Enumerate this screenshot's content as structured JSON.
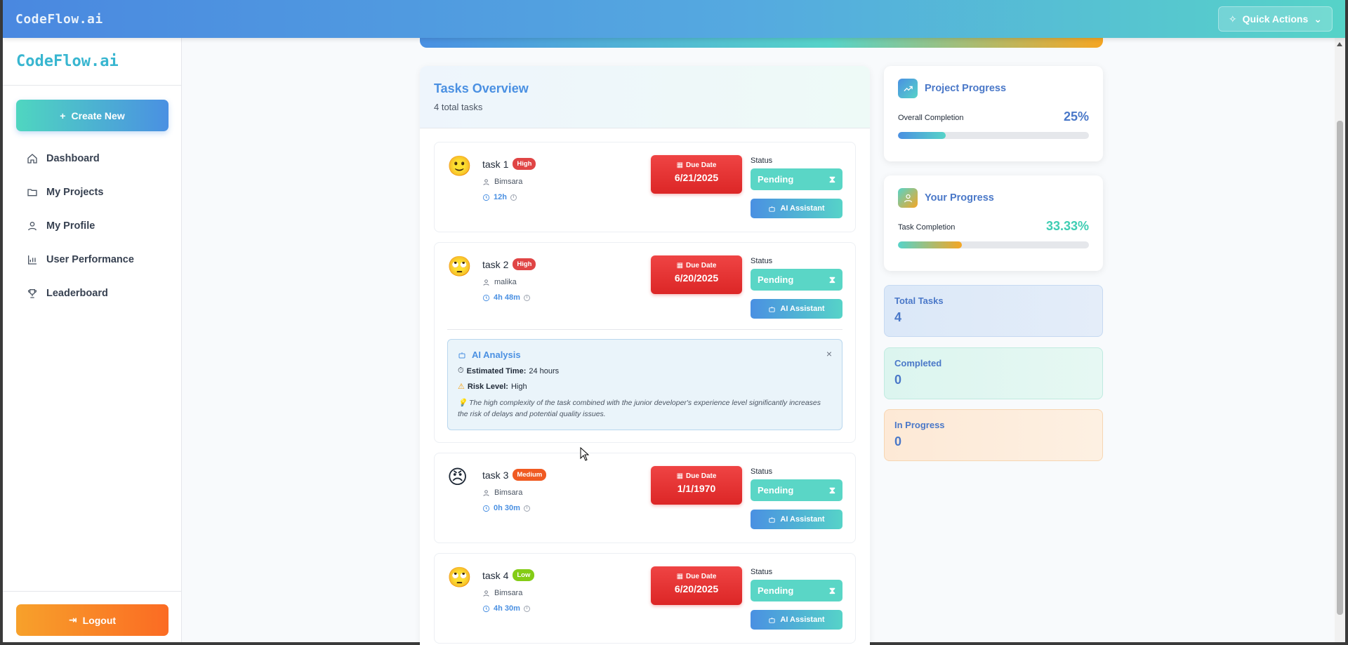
{
  "topbar": {
    "brand": "CodeFlow.ai",
    "quick_actions_label": "Quick Actions"
  },
  "sidebar": {
    "brand": "CodeFlow.ai",
    "create_label": "Create New",
    "items": [
      {
        "label": "Dashboard",
        "icon": "home-icon"
      },
      {
        "label": "My Projects",
        "icon": "folder-icon"
      },
      {
        "label": "My Profile",
        "icon": "user-icon"
      },
      {
        "label": "User Performance",
        "icon": "bar-chart-icon"
      },
      {
        "label": "Leaderboard",
        "icon": "trophy-icon"
      }
    ],
    "logout_label": "Logout"
  },
  "tasks": {
    "title": "Tasks Overview",
    "subtitle": "4 total tasks",
    "due_label": "Due Date",
    "status_label": "Status",
    "ai_label": "AI Assistant",
    "items": [
      {
        "emoji": "🙂",
        "name": "task 1",
        "priority": "High",
        "assignee": "Bimsara",
        "time": "12h",
        "due": "6/21/2025",
        "status": "Pending"
      },
      {
        "emoji": "🙄",
        "name": "task 2",
        "priority": "High",
        "assignee": "malika",
        "time": "4h 48m",
        "due": "6/20/2025",
        "status": "Pending"
      },
      {
        "emoji": "😠",
        "name": "task 3",
        "priority": "Medium",
        "assignee": "Bimsara",
        "time": "0h 30m",
        "due": "1/1/1970",
        "status": "Pending"
      },
      {
        "emoji": "🙄",
        "name": "task 4",
        "priority": "Low",
        "assignee": "Bimsara",
        "time": "4h 30m",
        "due": "6/20/2025",
        "status": "Pending"
      }
    ],
    "analysis": {
      "title": "AI Analysis",
      "est_label": "Estimated Time:",
      "est_value": "24 hours",
      "risk_label": "Risk Level:",
      "risk_value": "High",
      "note": "The high complexity of the task combined with the junior developer's experience level significantly increases the risk of delays and potential quality issues."
    }
  },
  "project_progress": {
    "title": "Project Progress",
    "label": "Overall Completion",
    "value": "25%",
    "fill": 0.25
  },
  "your_progress": {
    "title": "Your Progress",
    "label": "Task Completion",
    "value": "33.33%",
    "fill": 0.3333
  },
  "stats": [
    {
      "label": "Total Tasks",
      "value": "4"
    },
    {
      "label": "Completed",
      "value": "0"
    },
    {
      "label": "In Progress",
      "value": "0"
    }
  ],
  "colors": {
    "accent_blue": "#4a90e2",
    "accent_teal": "#56d3c8",
    "danger": "#dc2626",
    "orange": "#f05a22"
  }
}
